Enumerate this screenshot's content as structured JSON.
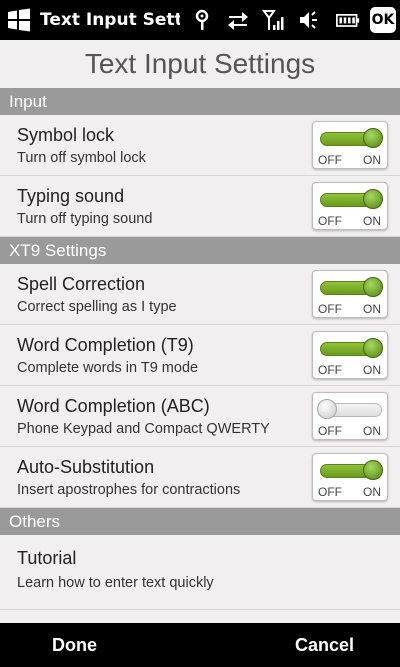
{
  "statusbar": {
    "title": "Text Input Setti",
    "ok_label": "OK",
    "icons": [
      "windows-logo-icon",
      "antenna-icon",
      "data-transfer-icon",
      "signal-strength-icon",
      "volume-icon",
      "battery-icon"
    ]
  },
  "page": {
    "title": "Text Input Settings"
  },
  "toggle_labels": {
    "off": "OFF",
    "on": "ON"
  },
  "sections": [
    {
      "header": "Input",
      "rows": [
        {
          "title": "Symbol lock",
          "subtitle": "Turn off symbol lock",
          "state": "on"
        },
        {
          "title": "Typing sound",
          "subtitle": "Turn off typing sound",
          "state": "on"
        }
      ]
    },
    {
      "header": "XT9 Settings",
      "rows": [
        {
          "title": "Spell Correction",
          "subtitle": "Correct spelling as I type",
          "state": "on"
        },
        {
          "title": "Word Completion (T9)",
          "subtitle": "Complete words in T9 mode",
          "state": "on"
        },
        {
          "title": "Word Completion (ABC)",
          "subtitle": "Phone Keypad and Compact QWERTY",
          "state": "off"
        },
        {
          "title": "Auto-Substitution",
          "subtitle": "Insert apostrophes for contractions",
          "state": "on"
        }
      ]
    },
    {
      "header": "Others",
      "rows": [
        {
          "title": "Tutorial",
          "subtitle": "Learn how to enter text quickly"
        }
      ]
    }
  ],
  "bottombar": {
    "done_label": "Done",
    "cancel_label": "Cancel"
  },
  "colors": {
    "accent_green": "#7cb32b",
    "section_header": "#9a9a9a",
    "background": "#f2eff0"
  }
}
